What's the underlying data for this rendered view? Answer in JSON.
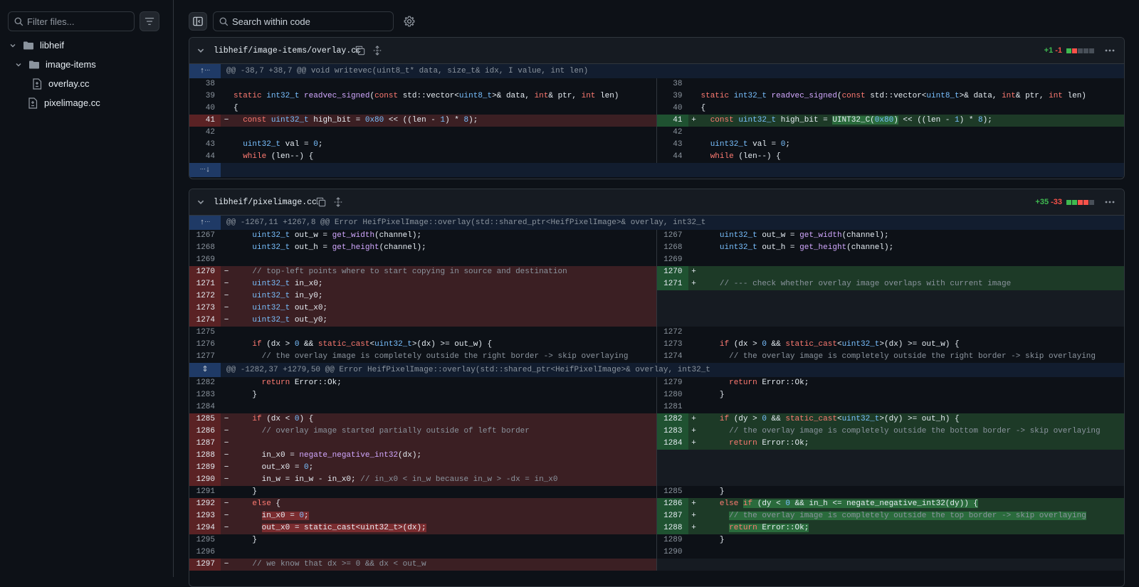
{
  "sidebar": {
    "filter_placeholder": "Filter files...",
    "tree": [
      {
        "label": "libheif",
        "type": "folder",
        "depth": 0
      },
      {
        "label": "image-items",
        "type": "folder",
        "depth": 1
      },
      {
        "label": "overlay.cc",
        "type": "file",
        "depth": 2
      },
      {
        "label": "pixelimage.cc",
        "type": "file",
        "depth": 1
      }
    ]
  },
  "toolbar": {
    "search_placeholder": "Search within code"
  },
  "files": [
    {
      "name": "libheif/image-items/overlay.cc",
      "added": "+1",
      "deleted": "-1",
      "hunk": "@@ -38,7 +38,7 @@ void writevec(uint8_t* data, size_t& idx, I value, int len)"
    },
    {
      "name": "libheif/pixelimage.cc",
      "added": "+35",
      "deleted": "-33",
      "hunk1": "@@ -1267,11 +1267,8 @@ Error HeifPixelImage::overlay(std::shared_ptr<HeifPixelImage>& overlay, int32_t",
      "hunk2": "@@ -1282,37 +1279,50 @@ Error HeifPixelImage::overlay(std::shared_ptr<HeifPixelImage>& overlay, int32_t"
    }
  ]
}
